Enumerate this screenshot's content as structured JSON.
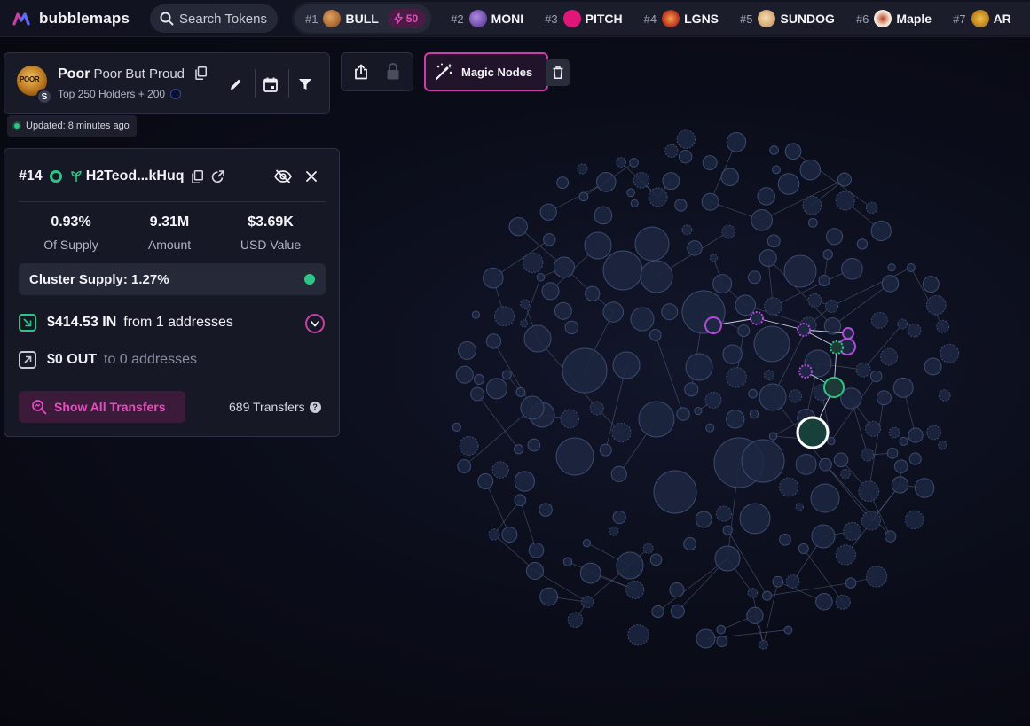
{
  "app": {
    "name": "bubblemaps"
  },
  "search": {
    "placeholder": "Search Tokens"
  },
  "trending": [
    {
      "rank": "#1",
      "name": "BULL",
      "boost": "50",
      "color": "#b06a2a"
    },
    {
      "rank": "#2",
      "name": "MONI",
      "color": "#7a4cc0"
    },
    {
      "rank": "#3",
      "name": "PITCH",
      "color": "#e0167a"
    },
    {
      "rank": "#4",
      "name": "LGNS",
      "color": "#c23a22"
    },
    {
      "rank": "#5",
      "name": "SUNDOG",
      "color": "#d9a46a"
    },
    {
      "rank": "#6",
      "name": "Maple",
      "color": "#e2e2e2"
    },
    {
      "rank": "#7",
      "name": "AR",
      "color": "#e0a020"
    }
  ],
  "token": {
    "symbol": "Poor",
    "name": "Poor But Proud",
    "subtitle": "Top 250 Holders + 200",
    "chain_badge": "S",
    "avatar_text": "POOR"
  },
  "status": {
    "updated": "Updated: 8 minutes ago"
  },
  "toolbar": {
    "magic_label": "Magic Nodes"
  },
  "wallet": {
    "rank": "#14",
    "address": "H2Teod...kHuq",
    "stats": [
      {
        "value": "0.93%",
        "label": "Of Supply"
      },
      {
        "value": "9.31M",
        "label": "Amount"
      },
      {
        "value": "$3.69K",
        "label": "USD Value"
      }
    ],
    "cluster_supply": "Cluster Supply: 1.27%",
    "inflow": {
      "amount": "$414.53 IN",
      "desc": "from 1 addresses"
    },
    "outflow": {
      "amount": "$0 OUT",
      "desc": "to 0 addresses"
    },
    "show_transfers_label": "Show All Transfers",
    "transfers_count": "689 Transfers"
  },
  "colors": {
    "accent_pink": "#c93fa8",
    "accent_green": "#2dc586",
    "bubble_fill": "#1f2a45",
    "bubble_stroke": "#3a4a70"
  }
}
